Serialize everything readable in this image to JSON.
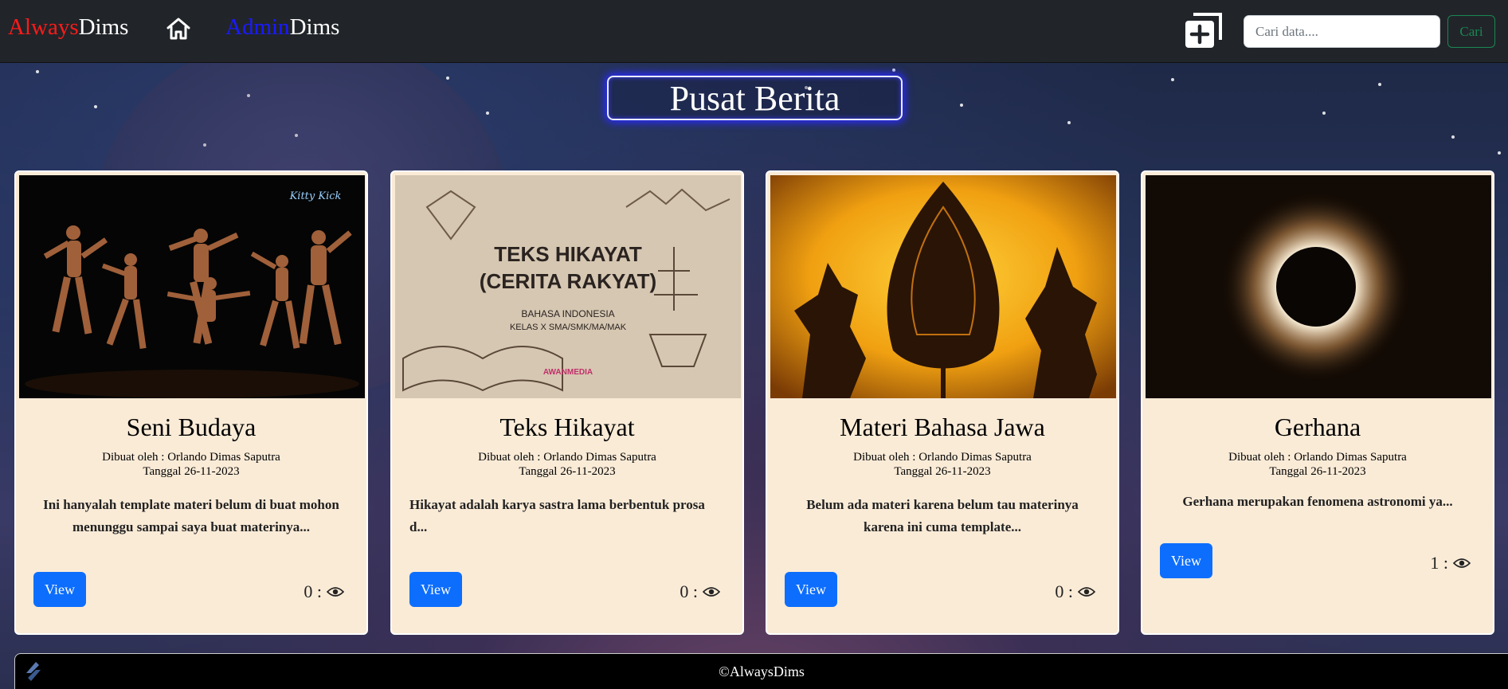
{
  "navbar": {
    "brand_part1": "Always",
    "brand_part2": "Dims",
    "admin_part1": "Admin",
    "admin_part2": "Dims",
    "search_placeholder": "Cari data....",
    "search_button": "Cari",
    "icons": [
      "home-icon",
      "add-copy-icon"
    ]
  },
  "page": {
    "title": "Pusat Berita"
  },
  "cards": [
    {
      "title": "Seni Budaya",
      "author": "Dibuat oleh : Orlando Dimas Saputra",
      "date": "Tanggal 26-11-2023",
      "description": "Ini hanyalah template materi belum di buat mohon menunggu sampai saya buat materinya...",
      "view_label": "View",
      "views": "0 :",
      "image_watermark": "Kitty Kick"
    },
    {
      "title": "Teks Hikayat",
      "author": "Dibuat oleh : Orlando Dimas Saputra",
      "date": "Tanggal 26-11-2023",
      "description": "Hikayat adalah karya sastra lama berbentuk prosa d...",
      "view_label": "View",
      "views": "0 :",
      "image_text": {
        "line1": "TEKS HIKAYAT",
        "line2": "(CERITA RAKYAT)",
        "line3": "BAHASA INDONESIA",
        "line4": "KELAS X SMA/SMK/MA/MAK",
        "line5": "AWANMEDIA"
      }
    },
    {
      "title": "Materi Bahasa Jawa",
      "author": "Dibuat oleh : Orlando Dimas Saputra",
      "date": "Tanggal 26-11-2023",
      "description": "Belum ada materi karena belum tau materinya karena ini cuma template...",
      "view_label": "View",
      "views": "0 :"
    },
    {
      "title": "Gerhana",
      "author": "Dibuat oleh : Orlando Dimas Saputra",
      "date": "Tanggal 26-11-2023",
      "description": "Gerhana merupakan fenomena astronomi ya...",
      "view_label": "View",
      "views": "1 :"
    }
  ],
  "footer": {
    "copyright": "©AlwaysDims"
  },
  "colors": {
    "navbar_bg": "#212529",
    "brand_red": "#ff1a1a",
    "admin_blue": "#1a1aff",
    "card_bg": "#faebd7",
    "view_button": "#0d6efd",
    "search_button": "#198754"
  }
}
